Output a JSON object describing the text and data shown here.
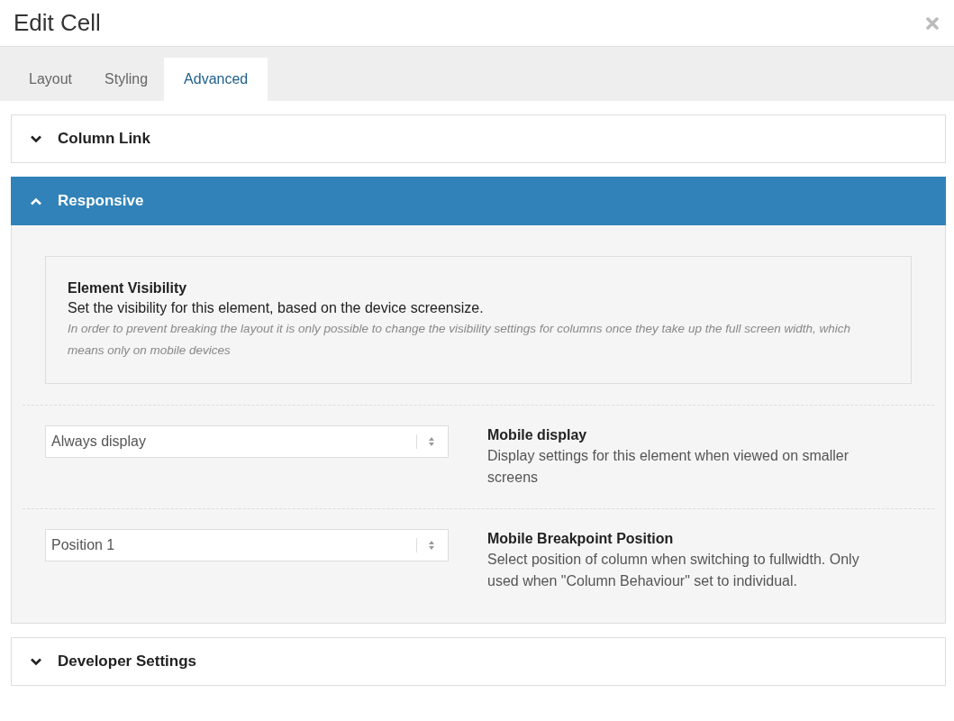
{
  "window": {
    "title": "Edit Cell"
  },
  "tabs": [
    {
      "label": "Layout",
      "selected": false
    },
    {
      "label": "Styling",
      "selected": false
    },
    {
      "label": "Advanced",
      "selected": true
    }
  ],
  "sections": [
    {
      "title": "Column Link",
      "expanded": false
    },
    {
      "title": "Responsive",
      "expanded": true,
      "info": {
        "title": "Element Visibility",
        "text": "Set the visibility for this element, based on the device screensize.",
        "note": "In order to prevent breaking the layout it is only possible to change the visibility settings for columns once they take up the full screen width, which means only on mobile devices"
      },
      "settings": [
        {
          "value": "Always display",
          "label": "Mobile display",
          "description": "Display settings for this element when viewed on smaller screens"
        },
        {
          "value": "Position 1",
          "label": "Mobile Breakpoint Position",
          "description": "Select position of column when switching to fullwidth. Only used when \"Column Behaviour\" set to individual."
        }
      ]
    },
    {
      "title": "Developer Settings",
      "expanded": false
    }
  ]
}
